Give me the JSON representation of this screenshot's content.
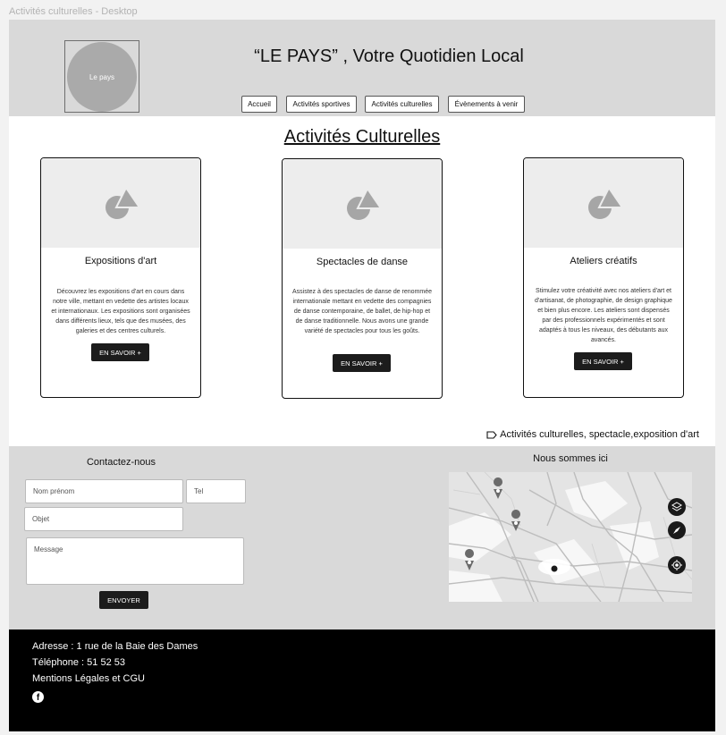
{
  "frame_title": "Activités culturelles - Desktop",
  "header": {
    "logo_text": "Le pays",
    "title": "“LE PAYS” , Votre Quotidien Local",
    "nav": [
      "Accueil",
      "Activités sportives",
      "Activités culturelles",
      "Évènements à venir"
    ]
  },
  "section_title": "Activités Culturelles",
  "cards": [
    {
      "title": "Expositions d'art",
      "description": "Découvrez les expositions d'art en cours dans notre ville, mettant en vedette des artistes locaux et internationaux. Les expositions sont organisées dans différents lieux, tels que des musées, des galeries et des centres culturels.",
      "button": "EN SAVOIR +"
    },
    {
      "title": "Spectacles de danse",
      "description": "Assistez à des spectacles de danse de renommée internationale mettant en vedette des compagnies de danse contemporaine, de ballet, de hip-hop et de danse traditionnelle. Nous avons une grande variété de spectacles pour tous les goûts.",
      "button": "EN SAVOIR +"
    },
    {
      "title": "Ateliers créatifs",
      "description": "Stimulez votre créativité avec nos ateliers d'art et d'artisanat, de photographie, de design graphique et bien plus encore. Les ateliers sont dispensés par des professionnels expérimentés et sont adaptés à tous les niveaux, des débutants aux avancés.",
      "button": "EN SAVOIR +"
    }
  ],
  "tags": "Activités culturelles, spectacle,exposition d'art",
  "contact": {
    "title": "Contactez-nous",
    "name_placeholder": "Nom prénom",
    "tel_placeholder": "Tel",
    "subject_placeholder": "Objet",
    "message_placeholder": "Message",
    "send_label": "ENVOYER"
  },
  "map": {
    "title": "Nous sommes ici",
    "controls": [
      "layers-icon",
      "compass-icon",
      "locate-icon"
    ]
  },
  "footer": {
    "address": "Adresse : 1 rue de la Baie des Dames",
    "phone": "Téléphone  : 51 52 53",
    "legal": "Mentions Légales et CGU",
    "social": "facebook-icon"
  }
}
